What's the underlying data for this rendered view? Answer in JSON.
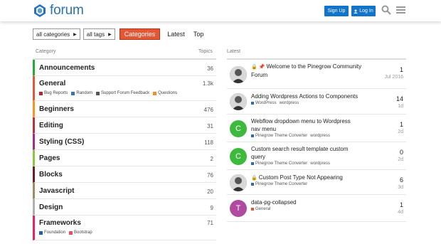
{
  "header": {
    "logo_text": "forum",
    "signup_label": "Sign Up",
    "login_label": "Log In"
  },
  "filters": {
    "categories_dropdown": "all categories",
    "tags_dropdown": "all tags",
    "nav": [
      "Categories",
      "Latest",
      "Top"
    ]
  },
  "columns": {
    "category": "Category",
    "topics": "Topics",
    "latest": "Latest"
  },
  "categories": [
    {
      "name": "Announcements",
      "count": "36",
      "color": "#25aa36"
    },
    {
      "name": "General",
      "count": "1.3k",
      "color": "#e45735",
      "subcategories": [
        {
          "label": "Bug Reports",
          "color": "#b3282f"
        },
        {
          "label": "Random",
          "color": "#3b72b0"
        },
        {
          "label": "Support Forum Feedback",
          "color": "#555555"
        },
        {
          "label": "Questions",
          "color": "#f08d2f"
        }
      ]
    },
    {
      "name": "Beginners",
      "count": "476",
      "color": "#f7941d"
    },
    {
      "name": "Editing",
      "count": "31",
      "color": "#b8323b"
    },
    {
      "name": "Styling (CSS)",
      "count": "118",
      "color": "#a12d8a"
    },
    {
      "name": "Pages",
      "count": "2",
      "color": "#8cc63f"
    },
    {
      "name": "Blocks",
      "count": "76",
      "color": "#6d1b2a"
    },
    {
      "name": "Javascript",
      "count": "20",
      "color": "#a08c64"
    },
    {
      "name": "Design",
      "count": "9",
      "color": "#b0b0b0"
    },
    {
      "name": "Frameworks",
      "count": "71",
      "color": "#e91e63",
      "subcategories": [
        {
          "label": "Foundation",
          "color": "#1f5fb0"
        },
        {
          "label": "Bootstrap",
          "color": "#e84c6a"
        }
      ]
    }
  ],
  "topics": [
    {
      "title_line1": "Welcome to the Pinegrow Community",
      "title_line2": "Forum",
      "category": "",
      "tag": "",
      "posts": "1",
      "time": "Jul 2016",
      "locked": true,
      "pinned": true,
      "avatar_letter": "",
      "avatar_color": "#666666"
    },
    {
      "title_line1": "Adding Wordpress Actions to Components",
      "title_line2": "",
      "category": "WordPress",
      "category_color": "#2a6bbf",
      "tag": "wordpress",
      "posts": "14",
      "time": "1d",
      "locked": false,
      "pinned": false,
      "avatar_letter": "",
      "avatar_color": "#5a5a5a"
    },
    {
      "title_line1": "Webflow dropdown menu to Wordpress",
      "title_line2": "nav menu",
      "category": "Pinegrow Theme Converter",
      "category_color": "#2a6bbf",
      "tag": "wordpress",
      "posts": "1",
      "time": "2d",
      "locked": false,
      "pinned": false,
      "avatar_letter": "C",
      "avatar_color": "#3db93d"
    },
    {
      "title_line1": "Custom search result template custom",
      "title_line2": "query",
      "category": "Pinegrow Theme Converter",
      "category_color": "#2a6bbf",
      "tag": "wordpress",
      "posts": "0",
      "time": "2d",
      "locked": false,
      "pinned": false,
      "avatar_letter": "C",
      "avatar_color": "#3db93d"
    },
    {
      "title_line1": "Custom Post Type Not Appearing",
      "title_line2": "",
      "category": "Pinegrow Theme Converter",
      "category_color": "#2a6bbf",
      "tag": "",
      "posts": "6",
      "time": "3d",
      "locked": true,
      "pinned": false,
      "avatar_letter": "",
      "avatar_color": "#666666"
    },
    {
      "title_line1": "data-pg-collapsed",
      "title_line2": "",
      "category": "General",
      "category_color": "#e45735",
      "tag": "",
      "posts": "1",
      "time": "4d",
      "locked": false,
      "pinned": false,
      "avatar_letter": "T",
      "avatar_color": "#b04aa0"
    }
  ]
}
